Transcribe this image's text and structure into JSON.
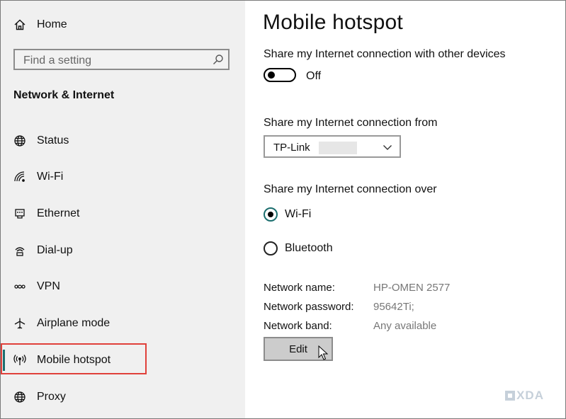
{
  "sidebar": {
    "home": {
      "label": "Home",
      "icon": "home-icon"
    },
    "search": {
      "placeholder": "Find a setting",
      "icon": "search-icon"
    },
    "section_title": "Network & Internet",
    "items": [
      {
        "label": "Status",
        "icon": "globe-icon"
      },
      {
        "label": "Wi-Fi",
        "icon": "wifi-icon"
      },
      {
        "label": "Ethernet",
        "icon": "ethernet-icon"
      },
      {
        "label": "Dial-up",
        "icon": "dialup-icon"
      },
      {
        "label": "VPN",
        "icon": "vpn-icon"
      },
      {
        "label": "Airplane mode",
        "icon": "airplane-icon"
      },
      {
        "label": "Mobile hotspot",
        "icon": "hotspot-icon",
        "active": true
      },
      {
        "label": "Proxy",
        "icon": "globe-icon"
      }
    ],
    "accent_color": "#1b6e6e",
    "highlight_color": "#e0403a"
  },
  "main": {
    "title": "Mobile hotspot",
    "share_label": "Share my Internet connection with other devices",
    "toggle_state": "Off",
    "from_label": "Share my Internet connection from",
    "from_value": "TP-Link",
    "over_label": "Share my Internet connection over",
    "over_options": [
      {
        "label": "Wi-Fi",
        "selected": true
      },
      {
        "label": "Bluetooth",
        "selected": false
      }
    ],
    "network_name_label": "Network name:",
    "network_name_value": "HP-OMEN 2577",
    "network_password_label": "Network password:",
    "network_password_value": "95642Ti;",
    "network_band_label": "Network band:",
    "network_band_value": "Any available",
    "edit_label": "Edit"
  },
  "watermark": {
    "text": "XDA"
  }
}
